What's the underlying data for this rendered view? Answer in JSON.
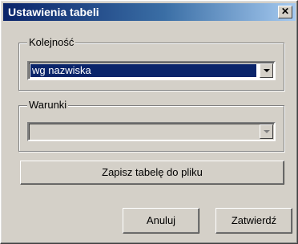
{
  "window": {
    "title": "Ustawienia tabeli",
    "close_label": "✕"
  },
  "order_group": {
    "label": "Kolejność",
    "selected": "wg nazwiska"
  },
  "conditions_group": {
    "label": "Warunki",
    "selected": ""
  },
  "buttons": {
    "save_to_file": "Zapisz tabelę do pliku",
    "cancel": "Anuluj",
    "confirm": "Zatwierdź"
  }
}
